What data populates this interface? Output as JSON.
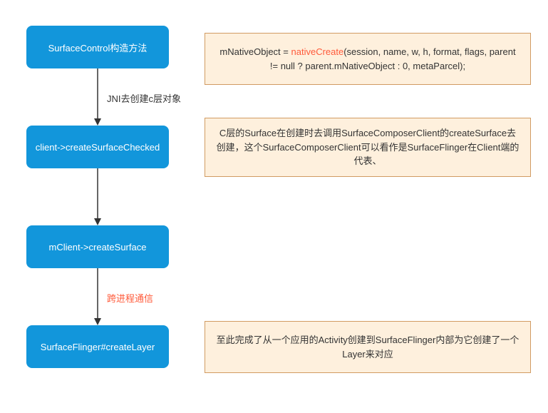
{
  "nodes": {
    "n1": "SurfaceControl构造方法",
    "n2": "client->createSurfaceChecked",
    "n3": "mClient->createSurface",
    "n4": "SurfaceFlinger#createLayer"
  },
  "edges": {
    "e1": "JNI去创建c层对象",
    "e2": "跨进程通信"
  },
  "notes": {
    "note1_prefix": "mNativeObject = ",
    "note1_call": "nativeCreate",
    "note1_suffix": "(session, name, w, h, format, flags, parent != null ? parent.mNativeObject : 0, metaParcel);",
    "note2": "C层的Surface在创建时去调用SurfaceComposerClient的createSurface去创建，这个SurfaceComposerClient可以看作是SurfaceFlinger在Client端的代表、",
    "note3": "至此完成了从一个应用的Activity创建到SurfaceFlinger内部为它创建了一个Layer来对应"
  }
}
